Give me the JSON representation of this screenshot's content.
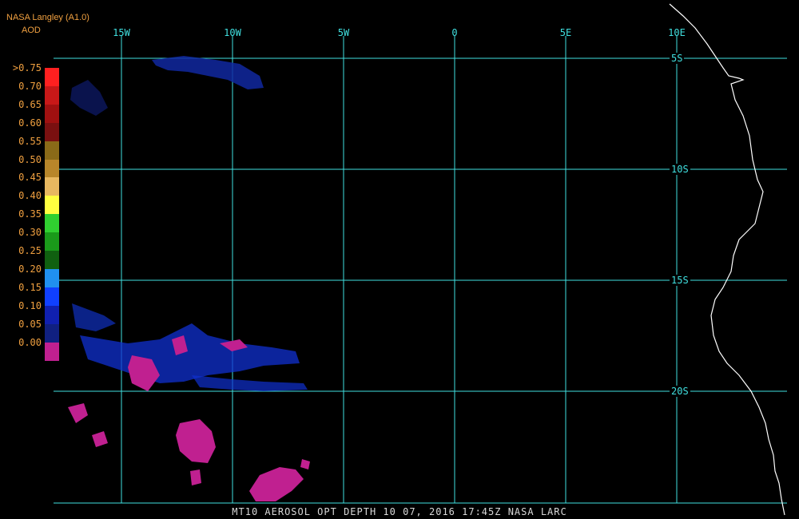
{
  "header": {
    "source": "NASA Langley (A1.0)",
    "product": "AOD"
  },
  "map": {
    "lon_labels": [
      "15W",
      "10W",
      "5W",
      "0",
      "5E",
      "10E"
    ],
    "lat_labels": [
      "5S",
      "10S",
      "15S",
      "20S"
    ],
    "grid_color": "#40e0e0",
    "coast_color": "#ffffff"
  },
  "legend": {
    "labels": [
      ">0.75",
      "0.70",
      "0.65",
      "0.60",
      "0.55",
      "0.50",
      "0.45",
      "0.40",
      "0.35",
      "0.30",
      "0.25",
      "0.20",
      "0.15",
      "0.10",
      "0.05",
      "0.00"
    ],
    "colors": [
      "#ff2020",
      "#c81818",
      "#a01010",
      "#7a1010",
      "#8a6a18",
      "#b8862a",
      "#e8b860",
      "#ffff40",
      "#30d030",
      "#1a9a1a",
      "#106010",
      "#2090f0",
      "#1040ff",
      "#1020b0",
      "#102080",
      "#c02090"
    ]
  },
  "footer": {
    "caption": "MT10  AEROSOL OPT DEPTH   10 07, 2016 17:45Z   NASA LARC"
  }
}
